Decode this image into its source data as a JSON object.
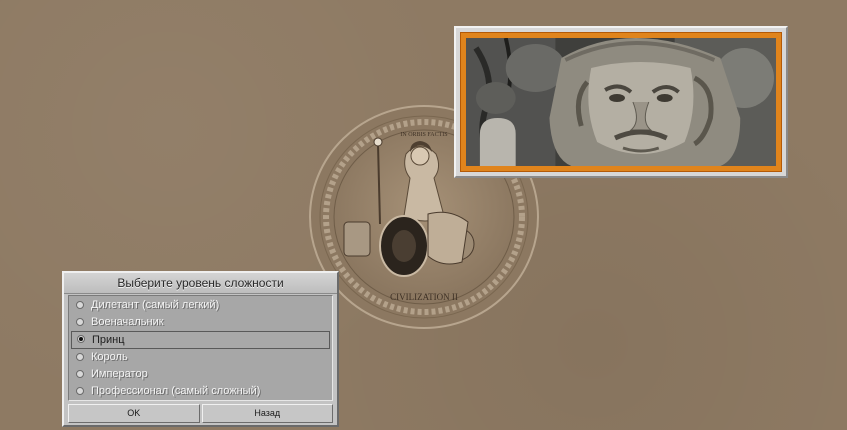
{
  "emblem": {
    "top_text": "IN ORBIS FACTIS",
    "bottom_text": "CIVILIZATION II"
  },
  "portrait": {
    "frame_color": "#e0841c"
  },
  "dialog": {
    "title": "Выберите уровень сложности",
    "options": [
      {
        "label": "Дилетант (самый легкий)",
        "selected": false
      },
      {
        "label": "Военачальник",
        "selected": false
      },
      {
        "label": "Принц",
        "selected": true
      },
      {
        "label": "Король",
        "selected": false
      },
      {
        "label": "Император",
        "selected": false
      },
      {
        "label": "Профессионал (самый сложный)",
        "selected": false
      }
    ],
    "ok_label": "OK",
    "back_label": "Назад"
  }
}
